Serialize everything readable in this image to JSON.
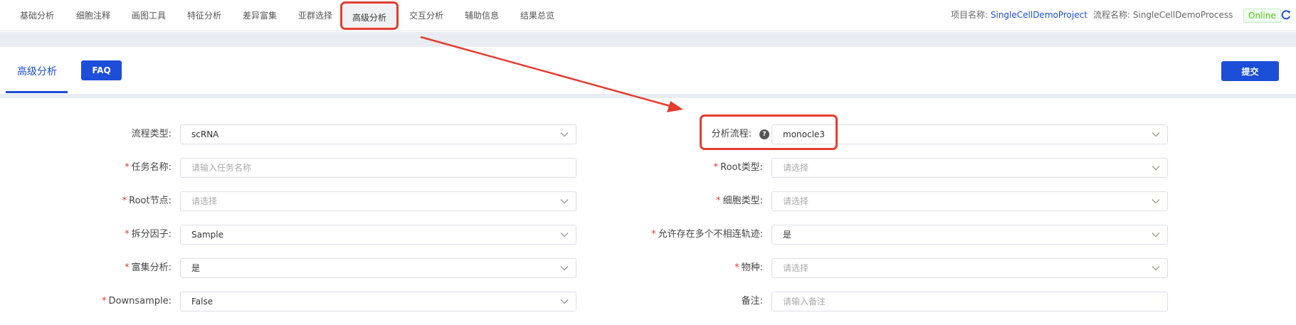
{
  "nav": {
    "items": [
      {
        "label": "基础分析"
      },
      {
        "label": "细胞注释"
      },
      {
        "label": "画图工具"
      },
      {
        "label": "特征分析"
      },
      {
        "label": "差异富集"
      },
      {
        "label": "亚群选择"
      },
      {
        "label": "高级分析",
        "active": true
      },
      {
        "label": "交互分析"
      },
      {
        "label": "辅助信息"
      },
      {
        "label": "结果总览"
      }
    ],
    "project_label": "项目名称:",
    "project_value": "SingleCellDemoProject",
    "process_label": "流程名称:",
    "process_value": "SingleCellDemoProcess",
    "status": "Online",
    "status_color": "#52c41a",
    "refresh_icon": "refresh-icon"
  },
  "tabs": {
    "active_label": "高级分析",
    "faq_label": "FAQ",
    "submit_label": "提交"
  },
  "colors": {
    "primary": "#1d4ed8",
    "annotation": "#e43d2f",
    "required": "#e43d2f"
  },
  "form": {
    "left": [
      {
        "label": "流程类型:",
        "required": false,
        "value": "scRNA",
        "placeholder": "",
        "dropdown": true
      },
      {
        "label": "任务名称:",
        "required": true,
        "value": "",
        "placeholder": "请输入任务名称",
        "dropdown": false
      },
      {
        "label": "Root节点:",
        "required": true,
        "value": "",
        "placeholder": "请选择",
        "dropdown": true
      },
      {
        "label": "拆分因子:",
        "required": true,
        "value": "Sample",
        "placeholder": "",
        "dropdown": true
      },
      {
        "label": "富集分析:",
        "required": true,
        "value": "是",
        "placeholder": "",
        "dropdown": true
      },
      {
        "label": "Downsample:",
        "required": true,
        "value": "False",
        "placeholder": "",
        "dropdown": true
      }
    ],
    "right": [
      {
        "label": "分析流程:",
        "required": false,
        "help": true,
        "value": "monocle3",
        "placeholder": "",
        "dropdown": true
      },
      {
        "label": "Root类型:",
        "required": true,
        "value": "",
        "placeholder": "请选择",
        "dropdown": true
      },
      {
        "label": "细胞类型:",
        "required": true,
        "value": "",
        "placeholder": "请选择",
        "dropdown": true
      },
      {
        "label": "允许存在多个不相连轨迹:",
        "required": true,
        "value": "是",
        "placeholder": "",
        "dropdown": true
      },
      {
        "label": "物种:",
        "required": true,
        "value": "",
        "placeholder": "请选择",
        "dropdown": true
      },
      {
        "label": "备注:",
        "required": false,
        "value": "",
        "placeholder": "请输入备注",
        "dropdown": false
      }
    ]
  }
}
